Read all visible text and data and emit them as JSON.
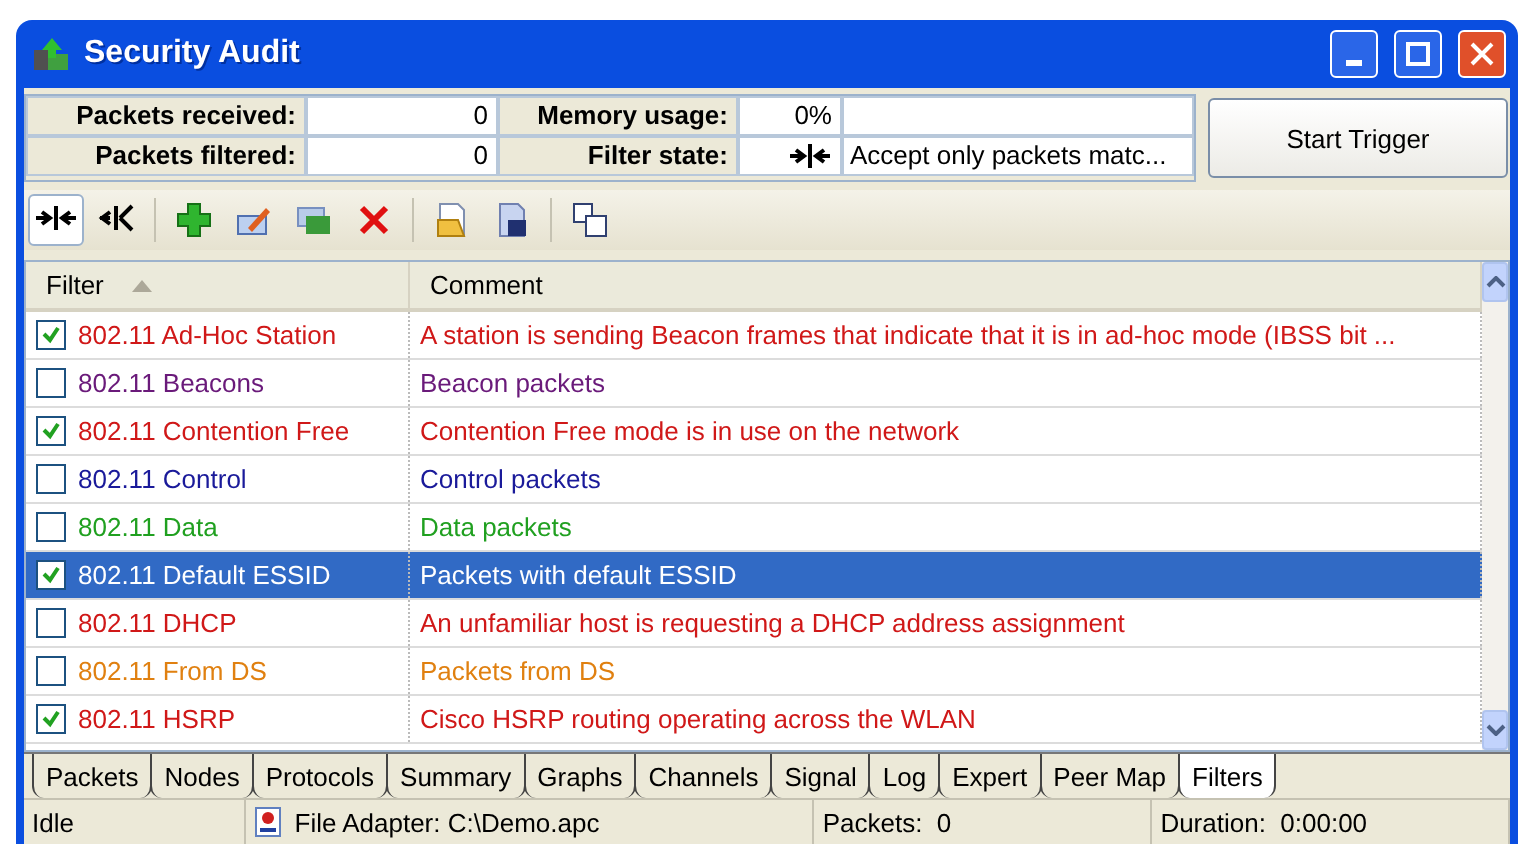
{
  "window": {
    "title": "Security Audit"
  },
  "stats": {
    "packets_received_label": "Packets received:",
    "packets_received": "0",
    "packets_filtered_label": "Packets filtered:",
    "packets_filtered": "0",
    "memory_label": "Memory usage:",
    "memory": "0%",
    "filter_state_label": "Filter state:",
    "filter_state": "Accept only packets matc..."
  },
  "trigger_button": "Start Trigger",
  "toolbar": [
    {
      "kind": "accept",
      "selected": true
    },
    {
      "kind": "reject",
      "selected": false
    },
    {
      "kind": "sep"
    },
    {
      "kind": "add",
      "selected": false
    },
    {
      "kind": "edit",
      "selected": false
    },
    {
      "kind": "duplicate",
      "selected": false
    },
    {
      "kind": "delete",
      "selected": false
    },
    {
      "kind": "sep"
    },
    {
      "kind": "open",
      "selected": false
    },
    {
      "kind": "save",
      "selected": false
    },
    {
      "kind": "sep"
    },
    {
      "kind": "windows",
      "selected": false
    }
  ],
  "table": {
    "columns": [
      {
        "label": "Filter",
        "sorted": true
      },
      {
        "label": "Comment",
        "sorted": false
      }
    ],
    "rows": [
      {
        "filter": "802.11 Ad-Hoc Station",
        "comment": "A station is sending Beacon frames that indicate that it is in ad-hoc mode (IBSS bit ...",
        "checked": true,
        "selected": false,
        "color": "#d01818"
      },
      {
        "filter": "802.11 Beacons",
        "comment": "Beacon packets",
        "checked": false,
        "selected": false,
        "color": "#6a1a7a"
      },
      {
        "filter": "802.11 Contention Free",
        "comment": "Contention Free mode is in use on the network",
        "checked": true,
        "selected": false,
        "color": "#d01818"
      },
      {
        "filter": "802.11 Control",
        "comment": "Control packets",
        "checked": false,
        "selected": false,
        "color": "#1a1a9a"
      },
      {
        "filter": "802.11 Data",
        "comment": "Data packets",
        "checked": false,
        "selected": false,
        "color": "#20a020"
      },
      {
        "filter": "802.11 Default ESSID",
        "comment": "Packets with default ESSID",
        "checked": true,
        "selected": true
      },
      {
        "filter": "802.11 DHCP",
        "comment": "An unfamiliar host is requesting a DHCP address assignment",
        "checked": false,
        "selected": false,
        "color": "#d01818"
      },
      {
        "filter": "802.11 From DS",
        "comment": "Packets from DS",
        "checked": false,
        "selected": false,
        "color": "#e08010"
      },
      {
        "filter": "802.11 HSRP",
        "comment": "Cisco HSRP routing operating across the WLAN",
        "checked": true,
        "selected": false,
        "color": "#d01818"
      }
    ]
  },
  "tabs": [
    {
      "label": "Packets",
      "selected": false
    },
    {
      "label": "Nodes",
      "selected": false
    },
    {
      "label": "Protocols",
      "selected": false
    },
    {
      "label": "Summary",
      "selected": false
    },
    {
      "label": "Graphs",
      "selected": false
    },
    {
      "label": "Channels",
      "selected": false
    },
    {
      "label": "Signal",
      "selected": false
    },
    {
      "label": "Log",
      "selected": false
    },
    {
      "label": "Expert",
      "selected": false
    },
    {
      "label": "Peer Map",
      "selected": false
    },
    {
      "label": "Filters",
      "selected": true
    }
  ],
  "status_bar": {
    "state": "Idle",
    "adapter": "File Adapter: C:\\Demo.apc",
    "packets": "Packets:  0",
    "duration": "Duration:  0:00:00"
  }
}
